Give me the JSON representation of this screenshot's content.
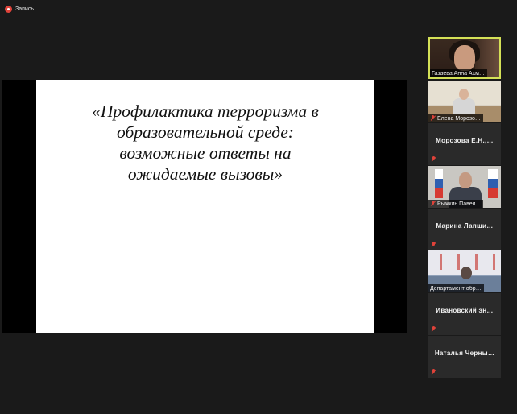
{
  "recording": {
    "label": "Запись"
  },
  "slide": {
    "title_lines": [
      "«Профилактика терроризма в",
      "образовательной среде:",
      "возможные ответы на",
      "ожидаемые вызовы»"
    ]
  },
  "participants": [
    {
      "name": "Газаева Анна Ахм…",
      "kind": "video",
      "active": true,
      "muted": false
    },
    {
      "name": "Елена Морозо…",
      "kind": "video",
      "active": false,
      "muted": true
    },
    {
      "name": "Морозова Е.Н.,…",
      "kind": "name",
      "active": false,
      "muted": true
    },
    {
      "name": "Рыжкин Павел…",
      "kind": "video",
      "active": false,
      "muted": true
    },
    {
      "name": "Марина Лапши…",
      "kind": "name",
      "active": false,
      "muted": true
    },
    {
      "name": "Департамент обр…",
      "kind": "video",
      "active": false,
      "muted": false
    },
    {
      "name": "Ивановский эн…",
      "kind": "name",
      "active": false,
      "muted": true
    },
    {
      "name": "Наталья Черны…",
      "kind": "name",
      "active": false,
      "muted": true
    }
  ],
  "colors": {
    "background": "#1a1a1a",
    "active_border": "#d4e157",
    "mute": "#e0433a"
  }
}
